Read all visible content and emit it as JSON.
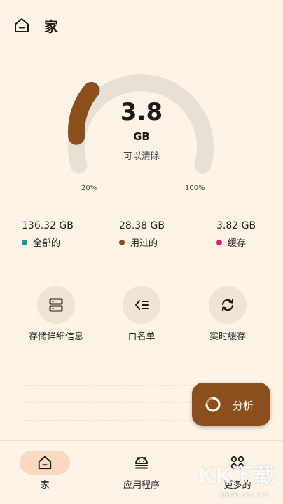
{
  "header": {
    "title": "家",
    "icon": "home-icon"
  },
  "gauge": {
    "value": "3.8",
    "unit": "GB",
    "caption": "可以清除",
    "min_label": "20%",
    "max_label": "100%",
    "fill_fraction": 0.17,
    "track_color": "#e8e0d5",
    "fill_color": "#8b4f1d"
  },
  "stats": [
    {
      "value": "136.32 GB",
      "label": "全部的",
      "color": "#1a9a8e"
    },
    {
      "value": "28.38 GB",
      "label": "用过的",
      "color": "#8b4f1d"
    },
    {
      "value": "3.82 GB",
      "label": "缓存",
      "color": "#e0205e"
    }
  ],
  "actions": [
    {
      "label": "存储详细信息",
      "icon": "storage-icon"
    },
    {
      "label": "白名单",
      "icon": "whitelist-icon"
    },
    {
      "label": "实时缓存",
      "icon": "refresh-icon"
    }
  ],
  "fab": {
    "label": "分析",
    "icon": "progress-ring-icon"
  },
  "nav": [
    {
      "label": "家",
      "icon": "home-icon",
      "active": true
    },
    {
      "label": "应用程序",
      "icon": "android-icon",
      "active": false
    },
    {
      "label": "更多的",
      "icon": "apps-grid-icon",
      "active": false
    }
  ],
  "watermark": {
    "logo": "KK下载",
    "url": "www.kkx.net"
  },
  "colors": {
    "background": "#fdf4e7",
    "accent": "#8b4f1d",
    "circle_bg": "#f0e4d5",
    "active_pill": "#fbd8c0"
  }
}
